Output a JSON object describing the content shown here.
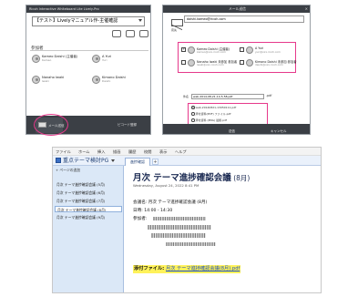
{
  "left_panel": {
    "title": "Ricoh Interactive Whiteboard Lite Lively-Pro",
    "meeting_title": "【テスト】Livelyマニュアル作-主催確認",
    "participants_header": "参加者",
    "participants": [
      {
        "name": "Kameo Daishi (主催者)",
        "sub": "Kameo"
      },
      {
        "name": "A Yuri",
        "sub": "Yuri"
      },
      {
        "name": "Nanaho Iwaki",
        "sub": "Iwaki"
      },
      {
        "name": "Kimono Daishi",
        "sub": "Daishi"
      }
    ],
    "mail_button_label": "メール送信",
    "icon_button_label": "ピコード登録"
  },
  "right_panel": {
    "title": "メール送信",
    "close_label": "×",
    "from_address": "daishi.kameo@ricoh.com",
    "env_label": "宛先",
    "recipients": [
      {
        "name": "Kameo Daishi (主催者)",
        "mail": "kameo@xxx.ricoh.com",
        "checked": true
      },
      {
        "name": "A Yuri",
        "mail": "yuri@xxx.ricoh.com",
        "checked": false
      },
      {
        "name": "Nanaho Iwaki 未参加 参加者",
        "mail": "iwaki@xxx.ricoh.com",
        "checked": false
      },
      {
        "name": "Kimono Daishi 未参加 参加者",
        "mail": "daishi@xxx.ricoh.com",
        "checked": false
      }
    ],
    "subject_prefix": "件名",
    "subject_value": "web-2014-08-21-14-5-58.pdf",
    "subject_ext": ".pdf",
    "formats": [
      {
        "label": "web-20140821-13050111.pdf",
        "selected": true
      },
      {
        "label": "添付資料(PDF) ファイル.pdf",
        "selected": false
      },
      {
        "label": "添付資料 (PNG) 最終.pdf",
        "selected": false
      }
    ],
    "ok_label": "送信",
    "cancel_label": "キャンセル"
  },
  "onenote": {
    "menus": [
      "ファイル",
      "ホーム",
      "挿入",
      "描画",
      "履歴",
      "校閲",
      "表示",
      "ヘルプ"
    ],
    "notebook_name": "重点テーマ検討PG",
    "tab_label": "進捗確認",
    "tab_plus": "+",
    "add_page_label": "+ ページの追加",
    "pages": [
      "月次 テーマ進捗確認会議 (5月)",
      "月次 テーマ進捗確認会議 (6月)",
      "月次 テーマ進捗確認会議 (7月)",
      "月次 テーマ進捗確認会議 (8月)",
      "月次 テーマ進捗確認会議 (9月)"
    ],
    "selected_page_index": 3,
    "page_title": "月次 テーマ進捗確認会議",
    "page_title_suffix": " (8月)",
    "page_date": "Wednesday, August 24, 2022    8:41 PM",
    "body_lines": [
      "会議名: 月次 テーマ進捗確認会議 (8月)",
      "日時: 14:00 - 14:30",
      "参加者:"
    ],
    "attach_label": "添付ファイル: ",
    "attach_file": "月次 テーマ進捗確認会議(8月).pdf"
  }
}
